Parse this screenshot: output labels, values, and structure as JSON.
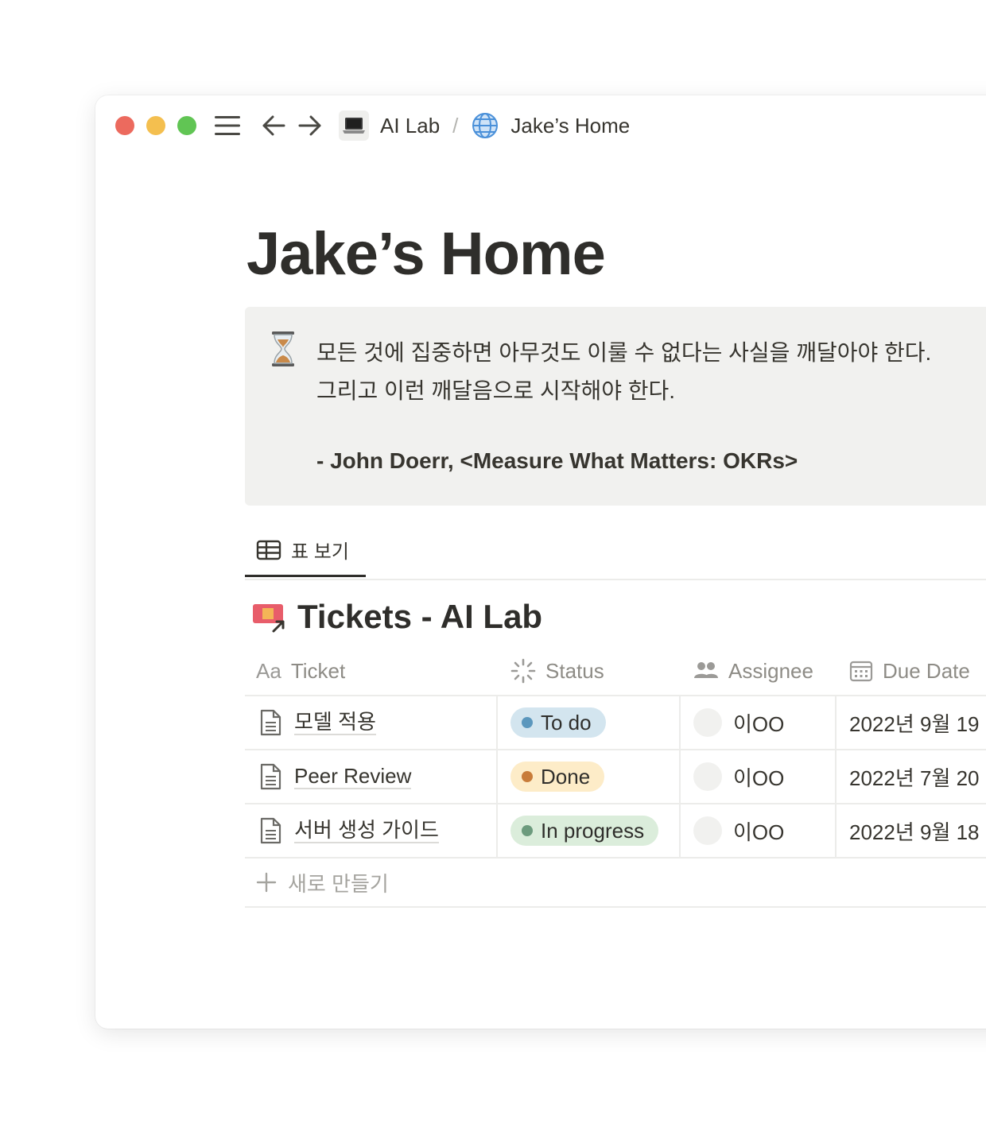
{
  "titlebar": {
    "breadcrumbs": [
      {
        "label": "AI Lab",
        "icon": "laptop-icon"
      },
      {
        "label": "Jake’s Home",
        "icon": "globe-icon"
      }
    ],
    "separator": "/"
  },
  "page": {
    "title": "Jake’s Home"
  },
  "callout": {
    "icon": "hourglass-icon",
    "line1": "모든 것에 집중하면 아무것도 이룰 수 없다는 사실을 깨달아야 한다.",
    "line2": "그리고 이런 깨달음으로 시작해야 한다.",
    "attribution": "- John Doerr, <Measure What Matters: OKRs>"
  },
  "views": {
    "active_tab": "표 보기",
    "active_tab_icon": "table-icon"
  },
  "database": {
    "title": "Tickets - AI Lab",
    "icon": "ticket-link-icon",
    "columns": {
      "ticket": {
        "prefix": "Aa",
        "label": "Ticket"
      },
      "status": {
        "label": "Status",
        "icon": "status-spinner-icon"
      },
      "assignee": {
        "label": "Assignee",
        "icon": "people-icon"
      },
      "due": {
        "label": "Due Date",
        "icon": "calendar-icon"
      }
    },
    "rows": [
      {
        "ticket": "모델 적용",
        "status": "To do",
        "assignee": "이OO",
        "due": "2022년 9월 19"
      },
      {
        "ticket": "Peer Review",
        "status": "Done",
        "assignee": "이OO",
        "due": "2022년 7월 20"
      },
      {
        "ticket": "서버 생성 가이드",
        "status": "In progress",
        "assignee": "이OO",
        "due": "2022년 9월 18"
      }
    ],
    "new_label": "새로 만들기",
    "status_colors": {
      "To do": "#d3e5ef",
      "Done": "#fdecc8",
      "In progress": "#dbeddb"
    }
  }
}
